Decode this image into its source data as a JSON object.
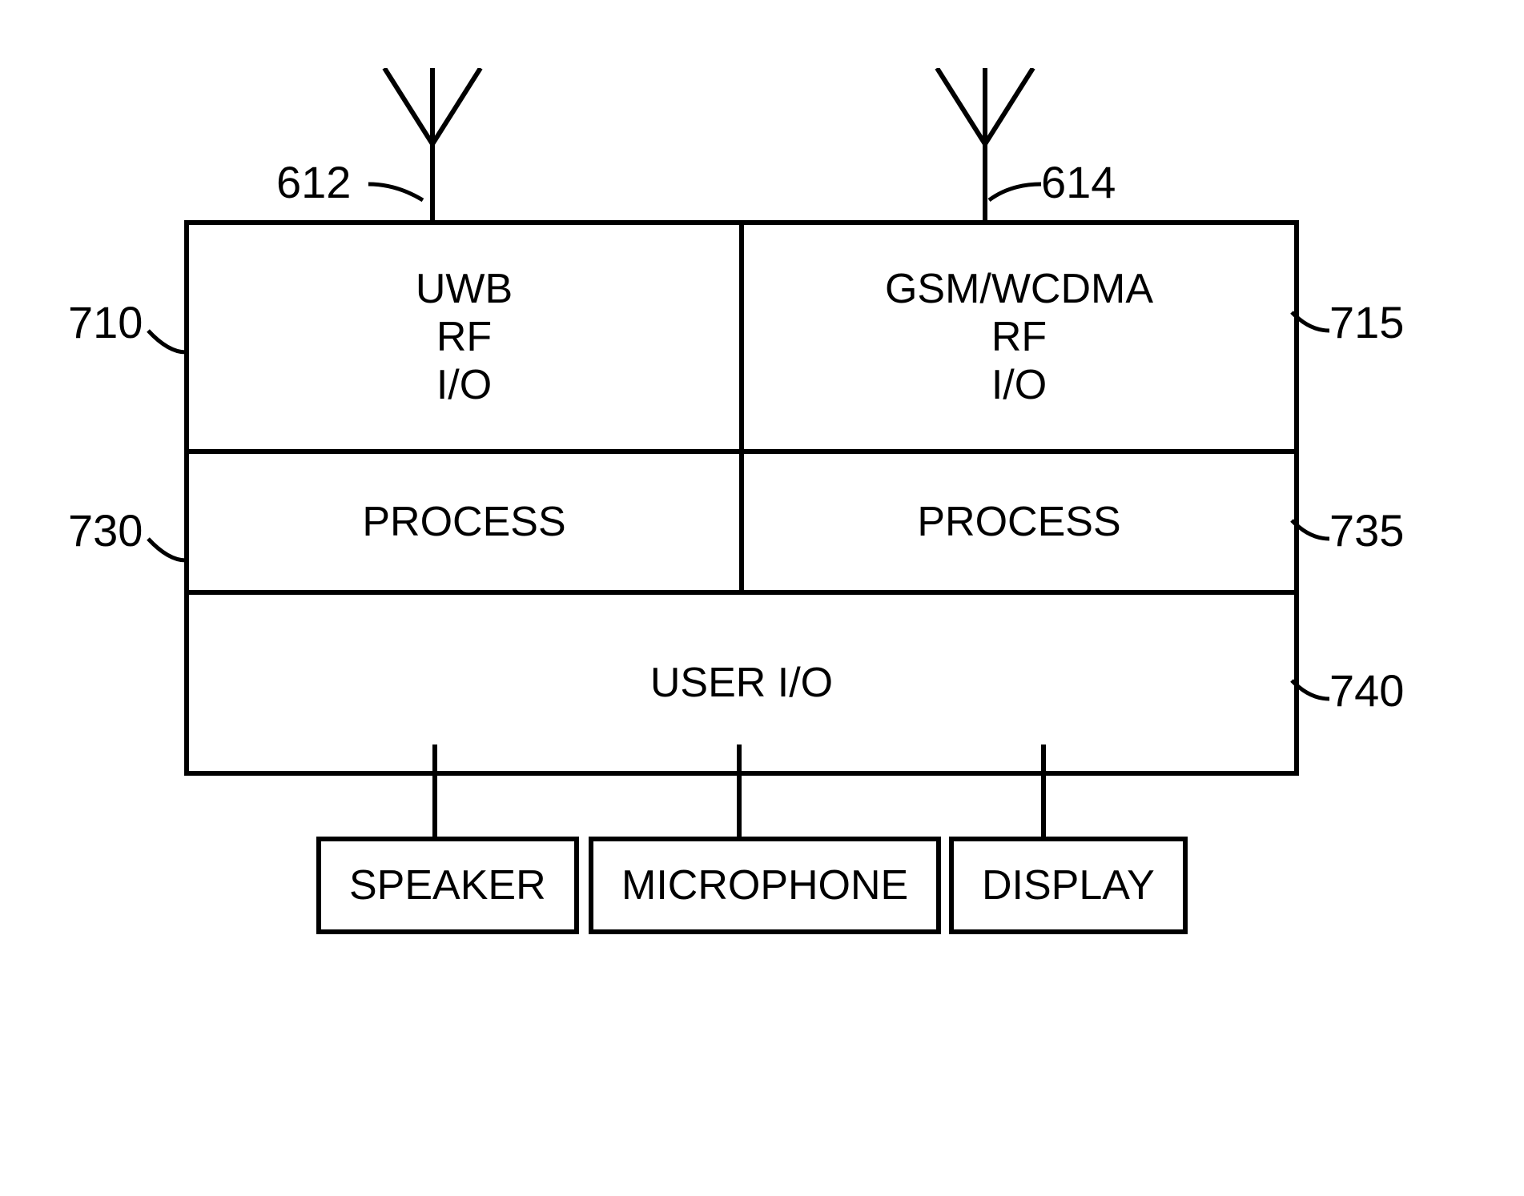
{
  "blocks": {
    "uwb": {
      "line1": "UWB",
      "line2": "RF",
      "line3": "I/O"
    },
    "gsm": {
      "line1": "GSM/WCDMA",
      "line2": "RF",
      "line3": "I/O"
    },
    "process_left": "PROCESS",
    "process_right": "PROCESS",
    "user_io": "USER I/O"
  },
  "labels": {
    "ref_612": "612",
    "ref_614": "614",
    "ref_710": "710",
    "ref_715": "715",
    "ref_730": "730",
    "ref_735": "735",
    "ref_740": "740"
  },
  "bottom_boxes": {
    "speaker": "SPEAKER",
    "microphone": "MICROPHONE",
    "display": "DISPLAY"
  }
}
